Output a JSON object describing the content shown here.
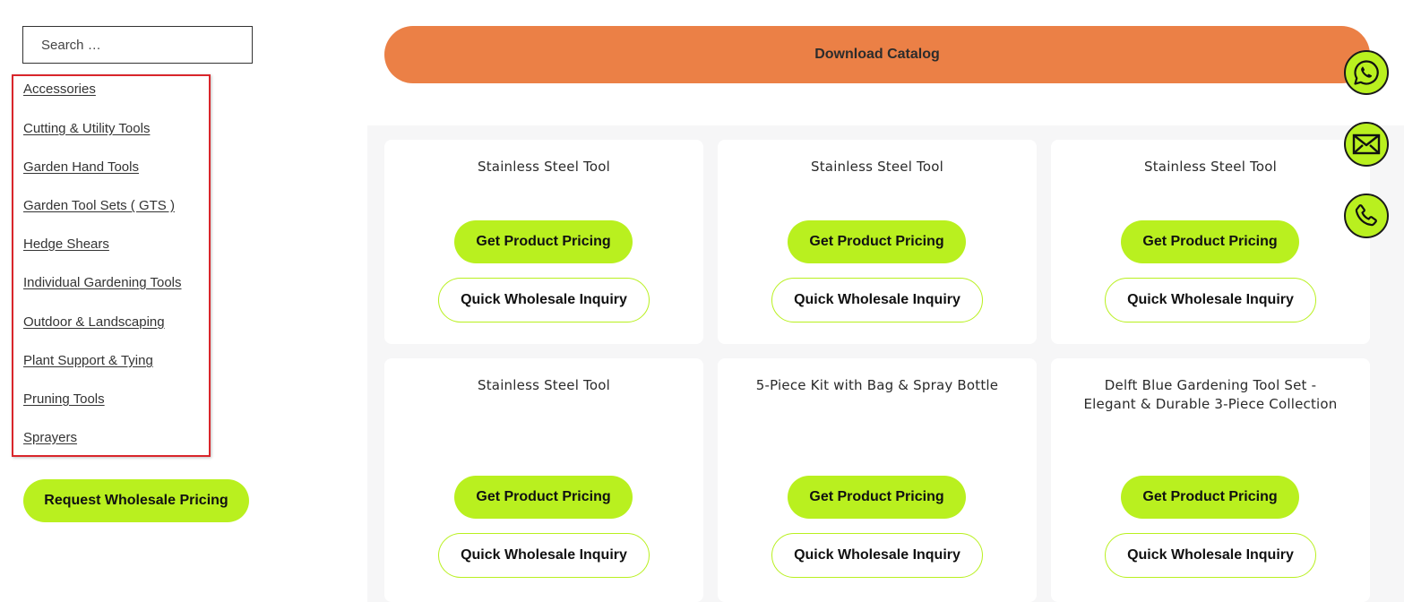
{
  "search": {
    "placeholder": "Search …"
  },
  "categories": [
    "Accessories",
    "Cutting & Utility Tools",
    "Garden Hand Tools",
    "Garden Tool Sets ( GTS )",
    "Hedge Shears",
    "Individual Gardening Tools",
    "Outdoor & Landscaping",
    "Plant Support & Tying",
    "Pruning Tools",
    "Sprayers"
  ],
  "sidebar": {
    "wholesale_button": "Request Wholesale Pricing"
  },
  "header": {
    "download_catalog": "Download Catalog"
  },
  "products": [
    {
      "title": "Stainless Steel Tool",
      "primary": "Get Product Pricing",
      "secondary": "Quick Wholesale Inquiry"
    },
    {
      "title": "Stainless Steel Tool",
      "primary": "Get Product Pricing",
      "secondary": "Quick Wholesale Inquiry"
    },
    {
      "title": "Stainless Steel Tool",
      "primary": "Get Product Pricing",
      "secondary": "Quick Wholesale Inquiry"
    },
    {
      "title": "Stainless Steel Tool",
      "primary": "Get Product Pricing",
      "secondary": "Quick Wholesale Inquiry"
    },
    {
      "title": "5-Piece Kit with Bag & Spray Bottle",
      "primary": "Get Product Pricing",
      "secondary": "Quick Wholesale Inquiry"
    },
    {
      "title": "Delft Blue Gardening Tool Set - Elegant & Durable 3-Piece Collection",
      "primary": "Get Product Pricing",
      "secondary": "Quick Wholesale Inquiry"
    }
  ],
  "contact_icons": [
    "whatsapp-icon",
    "email-icon",
    "phone-icon"
  ],
  "colors": {
    "accent_green": "#b9f01f",
    "download_orange": "#eb8046",
    "highlight_red": "#d9262b"
  }
}
